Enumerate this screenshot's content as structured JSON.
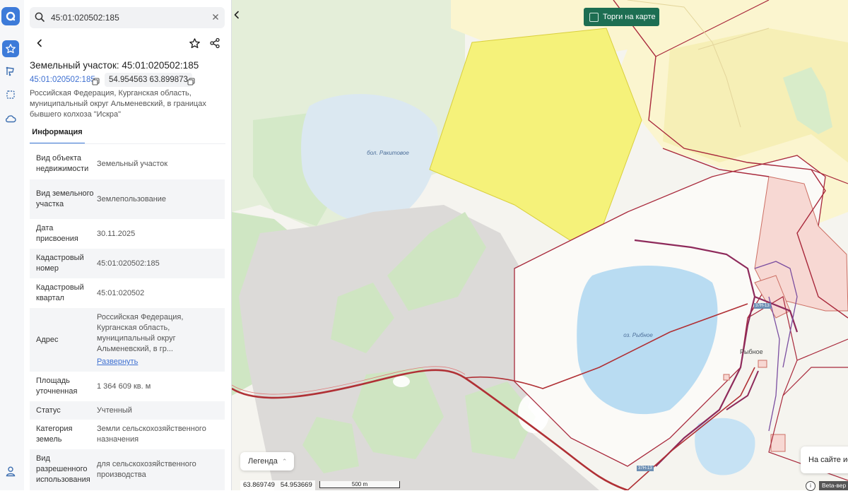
{
  "search": {
    "value": "45:01:020502:185"
  },
  "card": {
    "title": "Земельный участок: 45:01:020502:185",
    "cad_link": "45:01:020502:185",
    "coords": "54.954563 63.899873",
    "address": "Российская Федерация, Курганская область, муниципальный округ Альменевский, в границах бывшего колхоза \"Искра\"",
    "tab": "Информация"
  },
  "rows": [
    {
      "k": "Вид объекта недвижимости",
      "v": "Земельный участок"
    },
    {
      "k": "Вид земельного участка",
      "v": "Землепользование"
    },
    {
      "k": "Дата присвоения",
      "v": "30.11.2025"
    },
    {
      "k": "Кадастровый номер",
      "v": "45:01:020502:185"
    },
    {
      "k": "Кадастровый квартал",
      "v": "45:01:020502"
    },
    {
      "k": "Адрес",
      "v": "Российская Федерация, Курганская область, муниципальный округ Альменевский, в гр...",
      "more": "Развернуть"
    },
    {
      "k": "Площадь уточненная",
      "v": "1 364 609 кв. м"
    },
    {
      "k": "Статус",
      "v": "Учтенный"
    },
    {
      "k": "Категория земель",
      "v": "Земли сельскохозяйственного назначения"
    },
    {
      "k": "Вид разрешенного использования",
      "v": "для сельскохозяйственного производства"
    }
  ],
  "map": {
    "torgi_label": "Торги на карте",
    "legend_label": "Легенда",
    "coord_lon": "63.869749",
    "coord_lat": "54.953669",
    "scale_label": "500 m",
    "label_swamp": "бол. Ракитовое",
    "label_lake": "оз. Рыбное",
    "label_village": "Рыбное",
    "road_sign_1": "37Н-13",
    "road_sign_2": "37Н-13",
    "onsite_label": "На сайте ис",
    "beta_label": "Beta-вер",
    "info_label": "i"
  },
  "colors": {
    "accent": "#3d7bd9",
    "torgi_bg": "#1d6e52",
    "parcel_selected": "#f5f27a",
    "parcel_border": "#a8283b"
  },
  "icons": [
    "logo-icon",
    "star-icon",
    "route-icon",
    "select-area-icon",
    "cloud-icon",
    "user-icon",
    "search-icon",
    "close-icon",
    "back-icon",
    "favorite-icon",
    "share-icon",
    "copy-icon",
    "chevron-left-icon",
    "chevron-up-icon"
  ]
}
